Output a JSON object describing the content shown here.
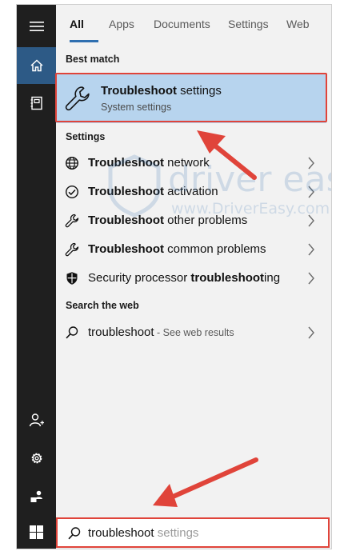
{
  "tabs": [
    "All",
    "Apps",
    "Documents",
    "Settings",
    "Web"
  ],
  "active_tab": "All",
  "sections": {
    "best_match": "Best match",
    "settings": "Settings",
    "search_web": "Search the web"
  },
  "best_match": {
    "title_bold": "Troubleshoot",
    "title_rest": " settings",
    "subtitle": "System settings"
  },
  "settings_items": [
    {
      "bold": "Troubleshoot",
      "rest": " network",
      "icon": "globe-icon"
    },
    {
      "bold": "Troubleshoot",
      "rest": " activation",
      "icon": "check-circle-icon"
    },
    {
      "bold": "Troubleshoot",
      "rest": " other problems",
      "icon": "wrench-icon"
    },
    {
      "bold": "Troubleshoot",
      "rest": " common problems",
      "icon": "wrench-icon"
    },
    {
      "pre": "Security processor ",
      "bold": "troubleshoot",
      "rest": "ing",
      "icon": "shield-icon"
    }
  ],
  "web_item": {
    "query": "troubleshoot",
    "sub": " - See web results"
  },
  "search": {
    "typed": "troubleshoot",
    "ghost": " settings"
  },
  "watermark": {
    "brand": "driver easy",
    "url": "www.DriverEasy.com"
  },
  "colors": {
    "rail": "#1f1f1f",
    "rail_active": "#2d5a86",
    "highlight": "#b7d4ee",
    "annotation": "#e0443a"
  }
}
